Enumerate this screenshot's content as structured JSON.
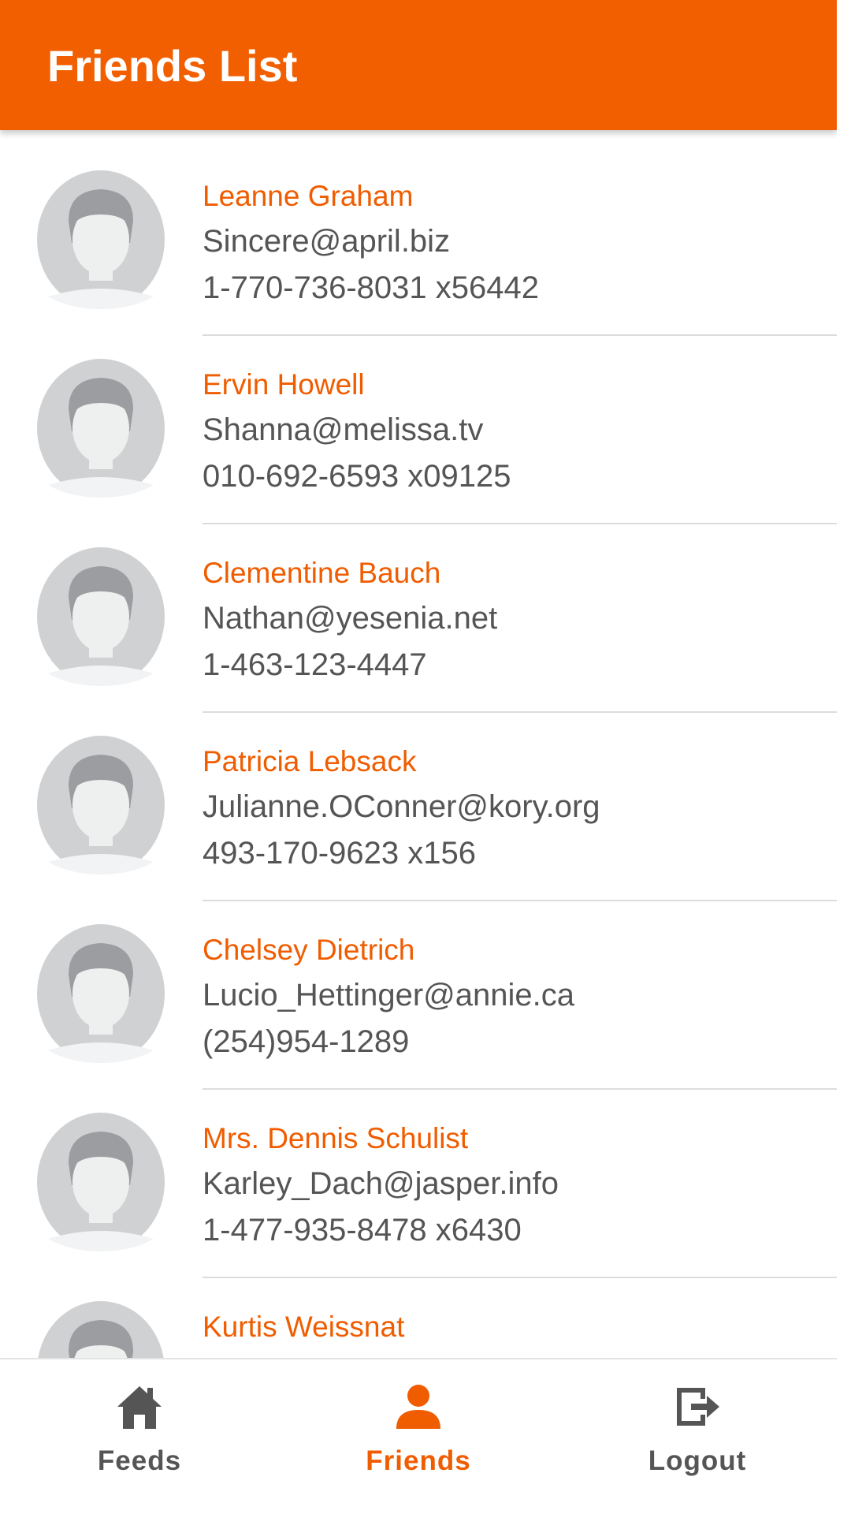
{
  "header": {
    "title": "Friends List"
  },
  "friends": [
    {
      "name": "Leanne Graham",
      "email": "Sincere@april.biz",
      "phone": "1-770-736-8031 x56442"
    },
    {
      "name": "Ervin Howell",
      "email": "Shanna@melissa.tv",
      "phone": "010-692-6593 x09125"
    },
    {
      "name": "Clementine Bauch",
      "email": "Nathan@yesenia.net",
      "phone": "1-463-123-4447"
    },
    {
      "name": "Patricia Lebsack",
      "email": "Julianne.OConner@kory.org",
      "phone": "493-170-9623 x156"
    },
    {
      "name": "Chelsey Dietrich",
      "email": "Lucio_Hettinger@annie.ca",
      "phone": "(254)954-1289"
    },
    {
      "name": "Mrs. Dennis Schulist",
      "email": "Karley_Dach@jasper.info",
      "phone": "1-477-935-8478 x6430"
    },
    {
      "name": "Kurtis Weissnat",
      "email": "",
      "phone": ""
    }
  ],
  "bottom_nav": {
    "items": [
      {
        "label": "Feeds",
        "icon": "home-icon"
      },
      {
        "label": "Friends",
        "icon": "person-icon"
      },
      {
        "label": "Logout",
        "icon": "logout-icon"
      }
    ],
    "active": "Friends"
  },
  "colors": {
    "accent": "#f25f00",
    "name_text": "#f05c00",
    "body_text": "#555555",
    "divider": "#dcdcdc"
  }
}
